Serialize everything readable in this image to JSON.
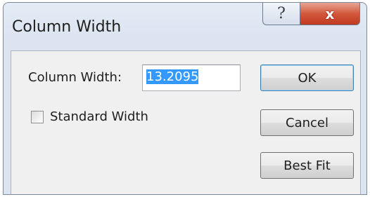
{
  "dialog": {
    "title": "Column Width",
    "help_glyph": "?",
    "close_glyph": "x"
  },
  "form": {
    "column_width_label": "Column Width:",
    "column_width_value": "13.2095",
    "standard_width_label": "Standard Width",
    "standard_width_checked": false
  },
  "buttons": {
    "ok": "OK",
    "cancel": "Cancel",
    "best_fit": "Best Fit"
  },
  "icons": {
    "help": "help-icon",
    "close": "close-icon"
  },
  "colors": {
    "selection": "#3399ff",
    "close_button": "#c23a1f"
  }
}
